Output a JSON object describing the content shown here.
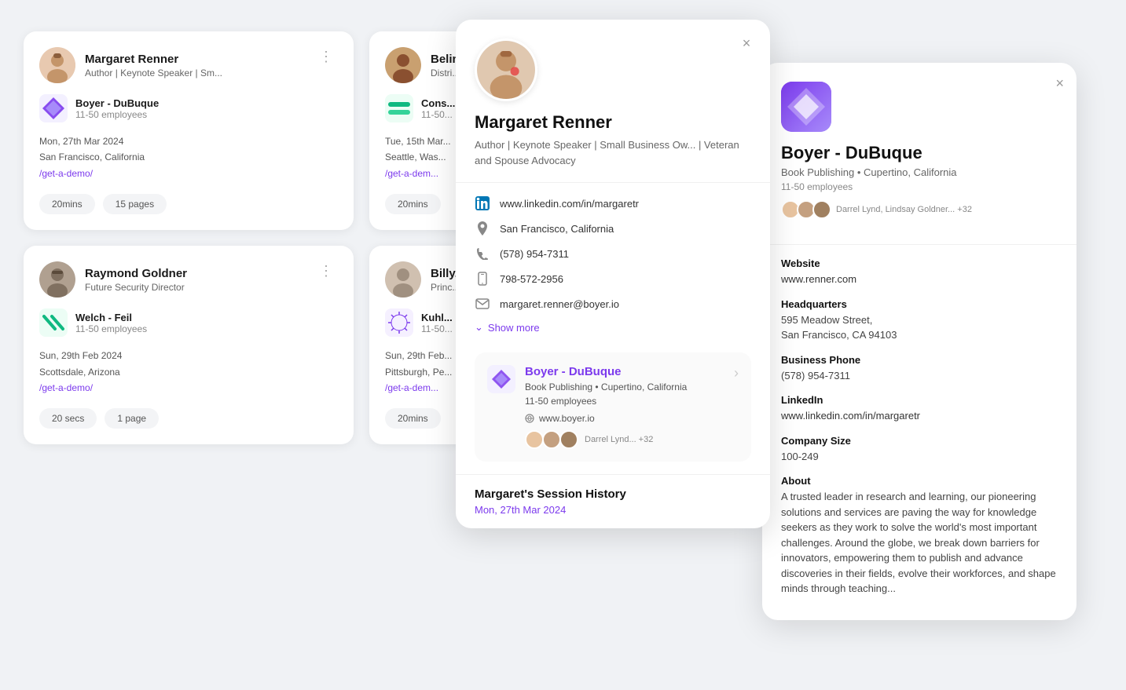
{
  "cards": [
    {
      "id": "margaret-renner",
      "name": "Margaret Renner",
      "title": "Author | Keynote Speaker | Sm...",
      "company": "Boyer - DuBuque",
      "companySize": "11-50 employees",
      "date": "Mon, 27th Mar 2024",
      "location": "San Francisco, California",
      "link": "/get-a-demo/",
      "duration": "20mins",
      "pages": "15 pages",
      "avatarColor": "#d4a080"
    },
    {
      "id": "belin",
      "name": "Belin...",
      "title": "Distri...",
      "company": "Cons...",
      "companySize": "11-50...",
      "date": "Tue, 15th Mar...",
      "location": "Seattle, Was...",
      "link": "/get-a-dem...",
      "duration": "20mins",
      "pages": "",
      "avatarColor": "#8a6040"
    },
    {
      "id": "raymond-goldner",
      "name": "Raymond Goldner",
      "title": "Future Security Director",
      "company": "Welch - Feil",
      "companySize": "11-50 employees",
      "date": "Sun, 29th Feb 2024",
      "location": "Scottsdale, Arizona",
      "link": "/get-a-demo/",
      "duration": "20 secs",
      "pages": "1 page",
      "avatarColor": "#807060"
    },
    {
      "id": "billy",
      "name": "Billy...",
      "title": "Princ...",
      "company": "Kuhl...",
      "companySize": "11-50...",
      "date": "Sun, 29th Feb...",
      "location": "Pittsburgh, Pe...",
      "link": "/get-a-dem...",
      "duration": "20mins",
      "pages": "",
      "avatarColor": "#a09080"
    }
  ],
  "personPanel": {
    "name": "Margaret Renner",
    "subtitle": "Author | Keynote Speaker | Small Business Ow... | Veteran and Spouse Advocacy",
    "linkedin": "www.linkedin.com/in/margaretr",
    "location": "San Francisco, California",
    "phone1": "(578) 954-7311",
    "phone2": "798-572-2956",
    "email": "margaret.renner@boyer.io",
    "showMoreLabel": "Show more",
    "companyName": "Boyer - DuBuque",
    "companyDetail": "Book Publishing • Cupertino, California",
    "companySize": "11-50 employees",
    "companyWebsite": "www.boyer.io",
    "companyContacts": "Darrel Lynd... +32",
    "sessionTitle": "Margaret's Session History",
    "sessionDate": "Mon, 27th Mar 2024",
    "closeLabel": "×"
  },
  "companyPanel": {
    "name": "Boyer - DuBuque",
    "subtitle": "Book Publishing • Cupertino, California",
    "size": "11-50 employees",
    "contacts": "Darrel Lynd, Lindsay Goldner... +32",
    "websiteLabel": "Website",
    "websiteValue": "www.renner.com",
    "headquartersLabel": "Headquarters",
    "headquartersValue": "595 Meadow Street,\nSan Francisco, CA 94103",
    "businessPhoneLabel": "Business Phone",
    "businessPhoneValue": "(578) 954-7311",
    "linkedinLabel": "LinkedIn",
    "linkedinValue": "www.linkedin.com/in/margaretr",
    "companySizeLabel": "Company Size",
    "companySizeValue": "100-249",
    "aboutLabel": "About",
    "aboutValue": "A trusted leader in research and learning, our pioneering solutions and services are paving the way for knowledge seekers as they work to solve the world's most important challenges. Around the globe, we break down barriers for innovators, empowering them to publish and advance discoveries in their fields, evolve their workforces, and shape minds through teaching...",
    "closeLabel": "×"
  },
  "icons": {
    "linkedin": "in",
    "location": "◎",
    "phone": "☎",
    "mobile": "📱",
    "email": "✉",
    "link": "🔗",
    "chevronDown": "⌄",
    "close": "×",
    "dots": "⋮"
  }
}
